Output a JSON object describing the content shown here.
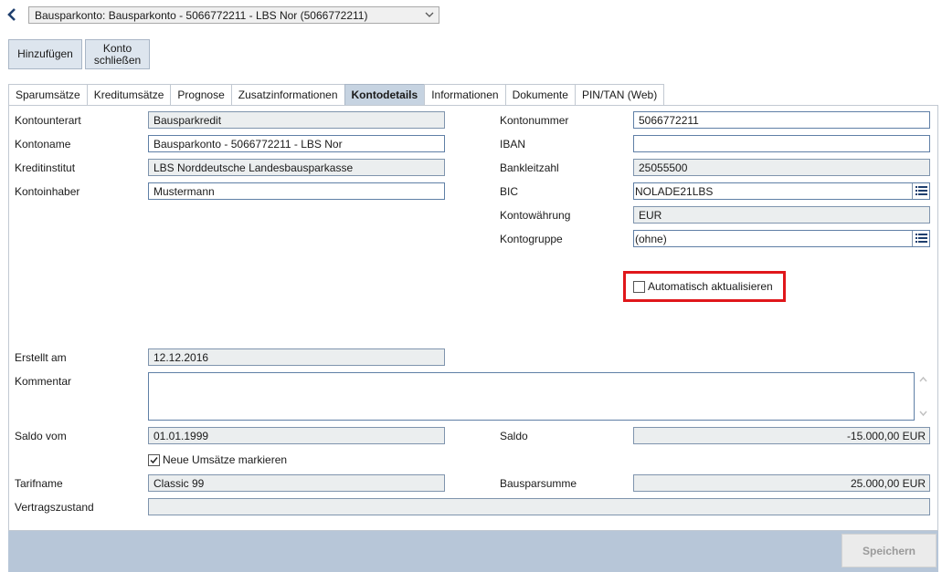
{
  "header": {
    "account_select": "Bausparkonto: Bausparkonto - 5066772211 - LBS Nor (5066772211)"
  },
  "toolbar": {
    "add_label": "Hinzufügen",
    "close_account_label": "Konto\nschließen"
  },
  "tabs": [
    {
      "label": "Sparumsätze"
    },
    {
      "label": "Kreditumsätze"
    },
    {
      "label": "Prognose"
    },
    {
      "label": "Zusatzinformationen"
    },
    {
      "label": "Kontodetails"
    },
    {
      "label": "Informationen"
    },
    {
      "label": "Dokumente"
    },
    {
      "label": "PIN/TAN (Web)"
    }
  ],
  "details": {
    "kontounterart": {
      "label": "Kontounterart",
      "value": "Bausparkredit"
    },
    "kontoname": {
      "label": "Kontoname",
      "value": "Bausparkonto - 5066772211 - LBS Nor"
    },
    "kreditinstitut": {
      "label": "Kreditinstitut",
      "value": "LBS Norddeutsche Landesbausparkasse"
    },
    "kontoinhaber": {
      "label": "Kontoinhaber",
      "value": "Mustermann"
    },
    "kontonummer": {
      "label": "Kontonummer",
      "value": "5066772211"
    },
    "iban": {
      "label": "IBAN",
      "value": ""
    },
    "bankleitzahl": {
      "label": "Bankleitzahl",
      "value": "25055500"
    },
    "bic": {
      "label": "BIC",
      "value": "NOLADE21LBS"
    },
    "kontowaehrung": {
      "label": "Kontowährung",
      "value": "EUR"
    },
    "kontogruppe": {
      "label": "Kontogruppe",
      "value": "(ohne)"
    },
    "auto_update": {
      "label": "Automatisch aktualisieren",
      "checked": false
    },
    "erstellt_am": {
      "label": "Erstellt am",
      "value": "12.12.2016"
    },
    "kommentar": {
      "label": "Kommentar",
      "value": ""
    },
    "saldo_vom": {
      "label": "Saldo vom",
      "value": "01.01.1999"
    },
    "saldo": {
      "label": "Saldo",
      "value": "-15.000,00 EUR"
    },
    "neue_umsaetze": {
      "label": "Neue Umsätze markieren",
      "checked": true
    },
    "tarifname": {
      "label": "Tarifname",
      "value": "Classic 99"
    },
    "bausparsumme": {
      "label": "Bausparsumme",
      "value": "25.000,00 EUR"
    },
    "vertragszustand": {
      "label": "Vertragszustand",
      "value": ""
    }
  },
  "footer": {
    "save_label": "Speichern"
  },
  "colors": {
    "accent": "#1f3f6e",
    "tab_active": "#c6d3e1",
    "footer_bar": "#b7c6d8",
    "highlight": "#e0171b"
  }
}
